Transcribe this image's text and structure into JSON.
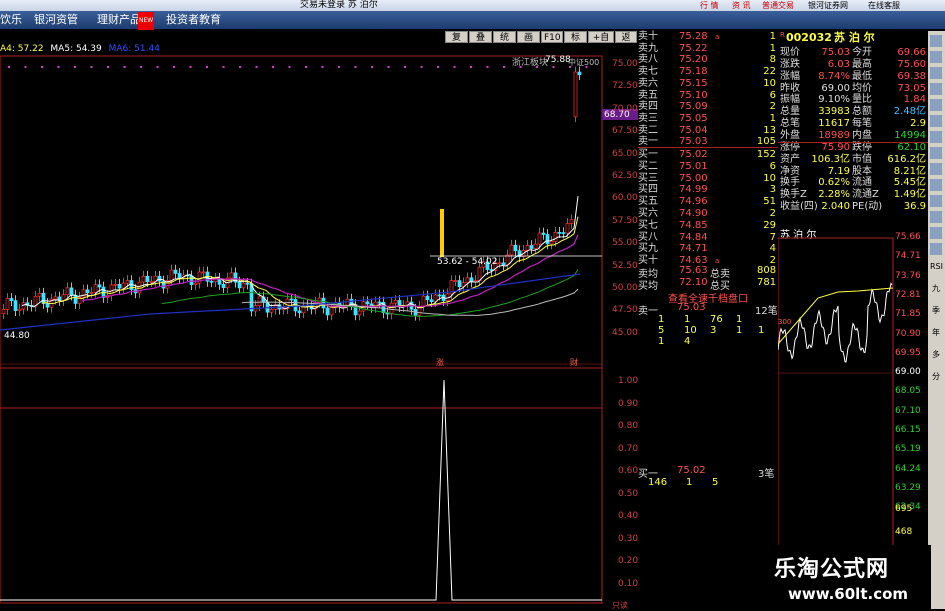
{
  "window": {
    "title": "交易未登录  苏 泊尔",
    "title_buttons": [
      "行 情",
      "资 讯",
      "普通交易",
      "银河证券网",
      "在线客服"
    ]
  },
  "menu": {
    "items": [
      "饮乐",
      "银河资管",
      "理财产品",
      "投资者教育"
    ],
    "new_badge": "NEW"
  },
  "toolbar": {
    "buttons": [
      "复权",
      "叠加",
      "统计",
      "画线",
      "F10",
      "标记",
      "+自选",
      "返回"
    ]
  },
  "ma": {
    "ma4": "A4: 57.22",
    "ma5": "MA5: 54.39",
    "ma6": "MA6: 51.44"
  },
  "chart": {
    "annot_sector": "浙江板块",
    "annot_high": "75.88",
    "annot_high_sub": "中证500",
    "annot_low_range": "53.62 - 54.02",
    "annot_min": "44.80",
    "current_price_tag": "68.70",
    "event_tags": [
      "涨",
      "财"
    ],
    "price_labels": [
      "75.00",
      "72.50",
      "70.00",
      "67.50",
      "65.00",
      "62.50",
      "60.00",
      "57.50",
      "55.00",
      "52.50",
      "50.00",
      "47.50",
      "45.00"
    ],
    "indicator_labels": [
      "1.00",
      "0.90",
      "0.80",
      "0.70",
      "0.60",
      "0.50",
      "0.40",
      "0.30",
      "0.20",
      "0.10"
    ],
    "bottom_tag": "只读"
  },
  "orderbook": {
    "sell": [
      {
        "label": "卖十",
        "price": "75.28",
        "flag": "a",
        "vol": "1"
      },
      {
        "label": "卖九",
        "price": "75.22",
        "flag": "",
        "vol": "1"
      },
      {
        "label": "卖八",
        "price": "75.20",
        "flag": "",
        "vol": "8"
      },
      {
        "label": "卖七",
        "price": "75.18",
        "flag": "",
        "vol": "22"
      },
      {
        "label": "卖六",
        "price": "75.15",
        "flag": "",
        "vol": "10"
      },
      {
        "label": "卖五",
        "price": "75.10",
        "flag": "",
        "vol": "6"
      },
      {
        "label": "卖四",
        "price": "75.09",
        "flag": "",
        "vol": "2"
      },
      {
        "label": "卖三",
        "price": "75.05",
        "flag": "",
        "vol": "1"
      },
      {
        "label": "卖二",
        "price": "75.04",
        "flag": "",
        "vol": "13"
      },
      {
        "label": "卖一",
        "price": "75.03",
        "flag": "",
        "vol": "105"
      }
    ],
    "buy": [
      {
        "label": "买一",
        "price": "75.02",
        "flag": "",
        "vol": "152"
      },
      {
        "label": "买二",
        "price": "75.01",
        "flag": "",
        "vol": "6"
      },
      {
        "label": "买三",
        "price": "75.00",
        "flag": "",
        "vol": "10"
      },
      {
        "label": "买四",
        "price": "74.99",
        "flag": "",
        "vol": "3"
      },
      {
        "label": "买五",
        "price": "74.96",
        "flag": "",
        "vol": "51"
      },
      {
        "label": "买六",
        "price": "74.90",
        "flag": "",
        "vol": "2"
      },
      {
        "label": "买七",
        "price": "74.85",
        "flag": "",
        "vol": "29"
      },
      {
        "label": "买八",
        "price": "74.84",
        "flag": "",
        "vol": "7"
      },
      {
        "label": "买九",
        "price": "74.71",
        "flag": "",
        "vol": "4"
      },
      {
        "label": "买十",
        "price": "74.63",
        "flag": "a",
        "vol": "2"
      }
    ],
    "avg_sell_label": "卖均",
    "avg_sell": "75.63",
    "total_sell_label": "总卖",
    "total_sell": "808",
    "avg_buy_label": "买均",
    "avg_buy": "72.10",
    "total_buy_label": "总买",
    "total_buy": "781",
    "full_depth_link": "查看全速千档盘口",
    "ask1_label": "卖一",
    "ask1_price": "75.03",
    "ask1_count": "12笔",
    "ask1_queue_rows": [
      [
        "1",
        "1",
        "76",
        "1"
      ],
      [
        "5",
        "10",
        "3",
        "1",
        "1"
      ],
      [
        "1",
        "4"
      ]
    ],
    "bid1_label": "买一",
    "bid1_price": "75.02",
    "bid1_count": "3笔",
    "bid1_queue_rows": [
      [
        "146",
        "1",
        "5"
      ]
    ]
  },
  "quote": {
    "code": "002032",
    "name": "苏 泊 尔",
    "marker": "R",
    "rows": [
      {
        "l1": "现价",
        "v1": "75.03",
        "l2": "今开",
        "v2": "69.66"
      },
      {
        "l1": "涨跌",
        "v1": "6.03",
        "l2": "最高",
        "v2": "75.60"
      },
      {
        "l1": "涨幅",
        "v1": "8.74%",
        "l2": "最低",
        "v2": "69.38"
      },
      {
        "l1": "昨收",
        "v1": "69.00",
        "l2": "均价",
        "v2": "73.05"
      },
      {
        "l1": "振幅",
        "v1": "9.10%",
        "l2": "量比",
        "v2": "1.84"
      },
      {
        "l1": "总量",
        "v1": "33983",
        "l2": "总额",
        "v2": "2.48亿"
      },
      {
        "l1": "总笔",
        "v1": "11617",
        "l2": "每笔",
        "v2": "2.9"
      },
      {
        "l1": "外盘",
        "v1": "18989",
        "l2": "内盘",
        "v2": "14994"
      },
      {
        "l1": "涨停",
        "v1": "75.90",
        "l2": "跌停",
        "v2": "62.10"
      },
      {
        "l1": "资产",
        "v1": "106.3亿",
        "l2": "市值",
        "v2": "616.2亿"
      },
      {
        "l1": "净资",
        "v1": "7.19",
        "l2": "股本",
        "v2": "8.21亿"
      },
      {
        "l1": "换手",
        "v1": "0.62%",
        "l2": "流通",
        "v2": "5.45亿"
      },
      {
        "l1": "换手Z",
        "v1": "2.28%",
        "l2": "流通Z",
        "v2": "1.49亿"
      },
      {
        "l1": "收益(四)",
        "v1": "2.040",
        "l2": "PE(动)",
        "v2": "36.9"
      }
    ]
  },
  "intraday": {
    "name": "苏 泊 尔",
    "price_labels": [
      "75.66",
      "74.71",
      "73.76",
      "72.81",
      "71.85",
      "70.90",
      "69.95",
      "69.00",
      "68.05",
      "67.10",
      "66.15",
      "65.19",
      "64.24",
      "63.29",
      "62.34"
    ],
    "vol_labels": [
      "695",
      "468"
    ],
    "left_marker": "300"
  },
  "side_tools": [
    "RSI",
    "九",
    "季",
    "年",
    "多",
    "分"
  ],
  "watermark": {
    "cn": "乐淘公式网",
    "url": "www.60lt.com"
  }
}
